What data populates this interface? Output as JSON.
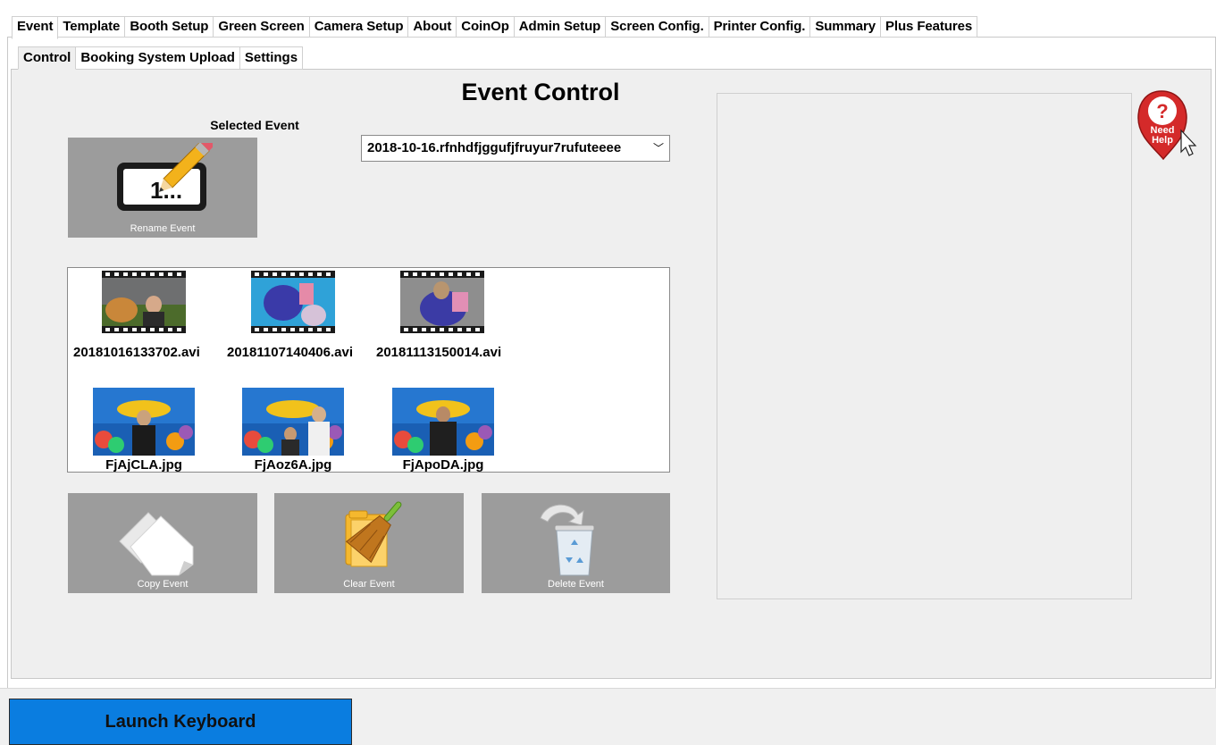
{
  "main_tabs": [
    "Event",
    "Template",
    "Booth Setup",
    "Green Screen",
    "Camera Setup",
    "About",
    "CoinOp",
    "Admin Setup",
    "Screen Config.",
    "Printer Config.",
    "Summary",
    "Plus Features"
  ],
  "sub_tabs": [
    "Control",
    "Booking System Upload",
    "Settings"
  ],
  "event_control": {
    "title": "Event Control",
    "selected_event_label": "Selected Event",
    "selected_event_value": "2018-10-16.rfnhdfjggufjfruyur7rufuteeee",
    "rename_label": "Rename Event",
    "rename_icon_text": "1..."
  },
  "media_files": [
    {
      "name": "20181016133702.avi",
      "icon": "video-thumbnail-icon"
    },
    {
      "name": "20181107140406.avi",
      "icon": "video-thumbnail-icon"
    },
    {
      "name": "20181113150014.avi",
      "icon": "video-thumbnail-icon"
    },
    {
      "name": "FjAjCLA.jpg",
      "icon": "image-thumbnail-icon"
    },
    {
      "name": "FjAoz6A.jpg",
      "icon": "image-thumbnail-icon"
    },
    {
      "name": "FjApoDA.jpg",
      "icon": "image-thumbnail-icon"
    }
  ],
  "buttons": {
    "copy": "Copy Event",
    "clear": "Clear Event",
    "delete": "Delete Event",
    "launch_keyboard": "Launch Keyboard"
  },
  "help": {
    "line1": "Need",
    "line2": "Help"
  },
  "colors": {
    "keyboard_button": "#0a7de0",
    "help_red": "#d42a2a",
    "button_gray": "#9c9c9c"
  }
}
